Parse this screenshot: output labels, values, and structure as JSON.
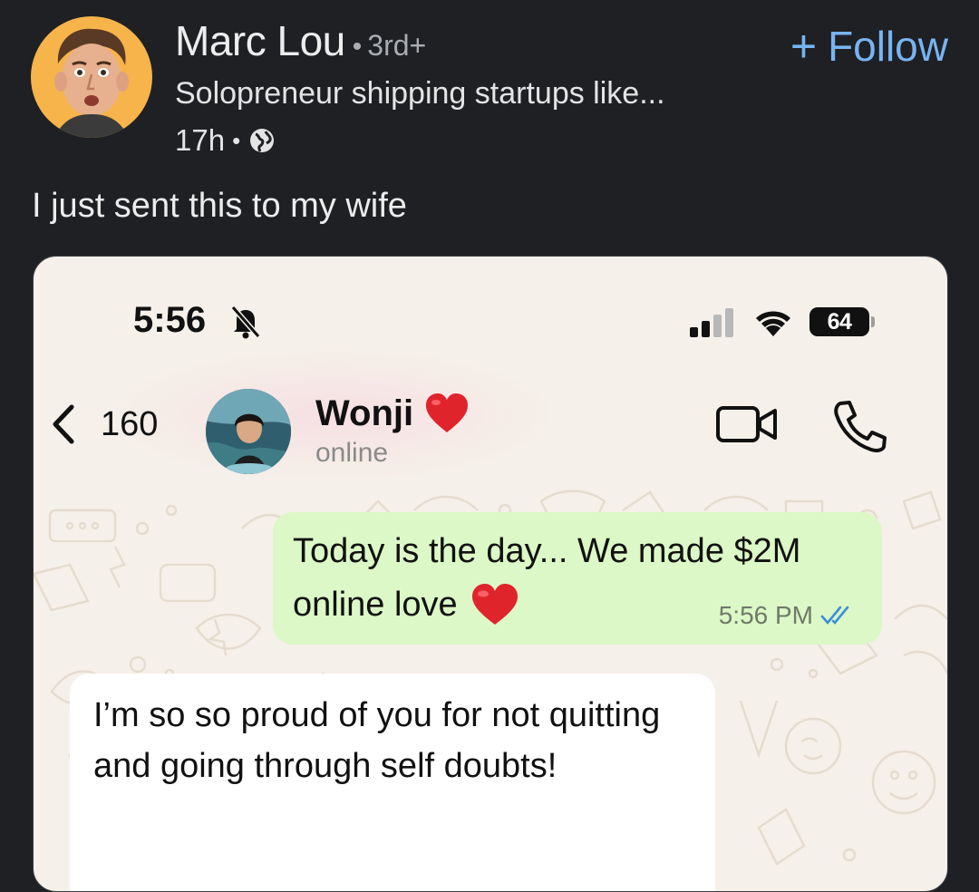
{
  "post": {
    "author_name": "Marc Lou",
    "separator": "•",
    "degree": "3rd+",
    "headline": "Solopreneur shipping startups like...",
    "time": "17h",
    "time_separator": "•",
    "visibility_icon": "globe-icon",
    "follow_plus": "+",
    "follow_label": "Follow",
    "text": "I just sent this to my wife"
  },
  "colors": {
    "background": "#1e2024",
    "follow_accent": "#78b4f2",
    "outgoing_bubble": "#dcf8c6",
    "incoming_bubble": "#ffffff",
    "chat_wallpaper": "#f5f0e9",
    "read_ticks": "#3a8fd8"
  },
  "screenshot": {
    "status_bar": {
      "time": "5:56",
      "bell_icon": "bell-slash-icon",
      "signal_icon": "cellular-signal-icon",
      "wifi_icon": "wifi-icon",
      "battery": "64"
    },
    "chat_header": {
      "back_count": "160",
      "contact_name": "Wonji",
      "contact_status": "online",
      "video_icon": "video-call-icon",
      "phone_icon": "phone-call-icon"
    },
    "messages": {
      "outgoing_line1": "Today is the day... We made $2M",
      "outgoing_line2": "online love",
      "outgoing_time": "5:56 PM",
      "incoming_text": "I’m so so proud of you for not quitting and going through self doubts!"
    }
  }
}
